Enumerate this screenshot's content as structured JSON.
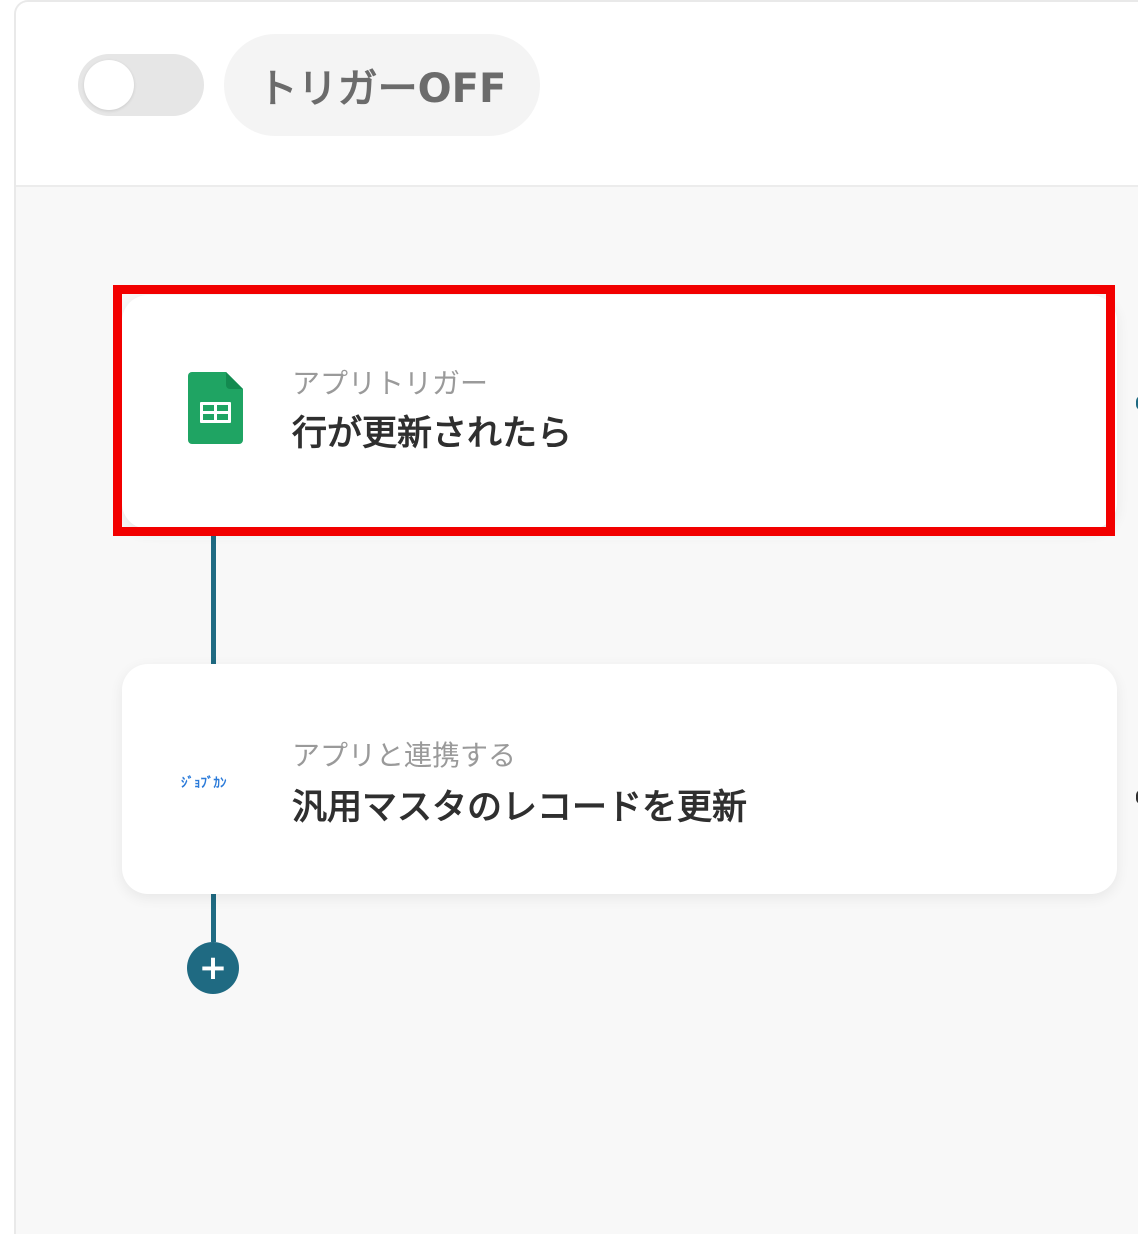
{
  "header": {
    "trigger_status_label": "トリガーOFF",
    "toggle_state": "off"
  },
  "flow": {
    "steps": [
      {
        "label": "アプリトリガー",
        "title": "行が更新されたら",
        "app_icon": "google-sheets-icon"
      },
      {
        "label": "アプリと連携する",
        "title": "汎用マスタのレコードを更新",
        "app_icon": "jobcan-logo",
        "logo_text": "ｼﾞｮﾌﾞｶﾝ"
      }
    ],
    "add_step_icon": "plus-icon"
  },
  "colors": {
    "highlight": "#f20000",
    "connector": "#1f6a82",
    "sheets_green": "#1fa463",
    "jobcan_blue": "#2a7ad9"
  }
}
